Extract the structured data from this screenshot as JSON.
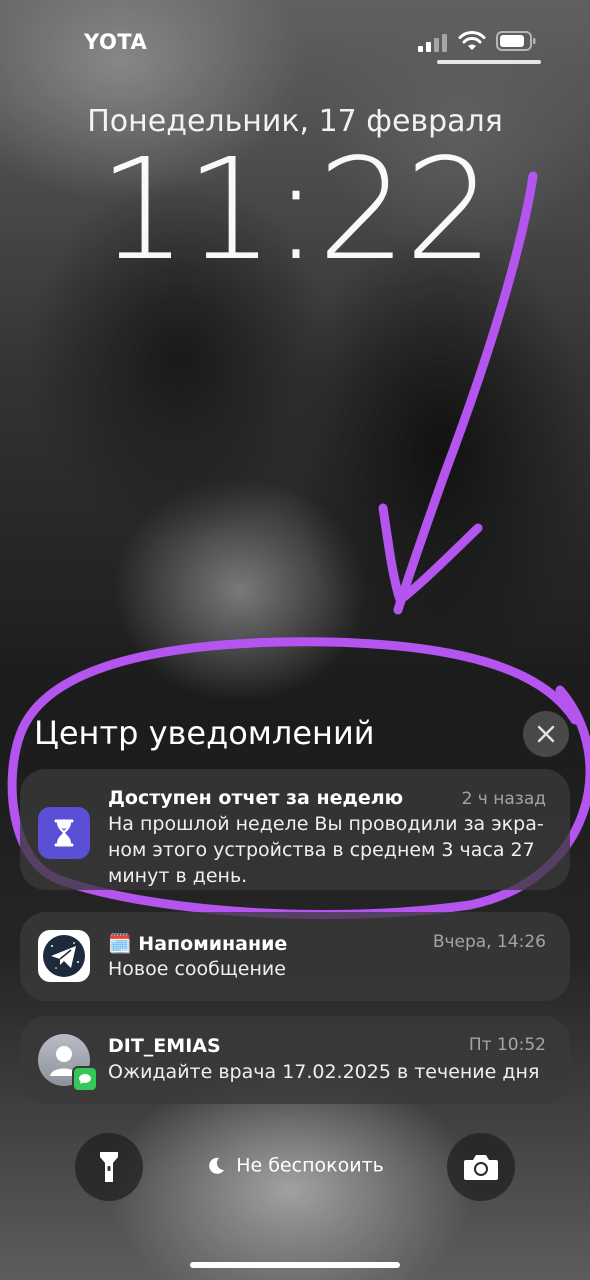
{
  "status_bar": {
    "carrier": "YOTA",
    "signal_bars_active": 2,
    "signal_bars_total": 4
  },
  "lock_screen": {
    "date": "Понедельник, 17 февраля",
    "time": "11:22"
  },
  "notification_center": {
    "title": "Центр уведомлений",
    "close_icon": "xmark-icon",
    "notifications": [
      {
        "app_icon": "hourglass-icon",
        "title": "Доступен отчет за неделю",
        "time": "2 ч назад",
        "body_lines": [
          "На прошлой неделе Вы проводили за экра-",
          "ном этого устройства в среднем 3 часа 27",
          "минут в день."
        ]
      },
      {
        "app_icon": "paper-plane-icon",
        "title_emoji": "🗓️",
        "title": "Напоминание",
        "time": "Вчера, 14:26",
        "body_lines": [
          "Новое сообщение"
        ]
      },
      {
        "app_icon": "person-avatar-icon",
        "badge_icon": "messages-bubble-icon",
        "title": "DIT_EMIAS",
        "time": "Пт 10:52",
        "body_lines": [
          "Ожидайте врача 17.02.2025 в течение дня"
        ]
      }
    ]
  },
  "bottom_bar": {
    "flashlight_icon": "flashlight-icon",
    "dnd_icon": "moon-icon",
    "dnd_label": "Не беспокоить",
    "camera_icon": "camera-icon"
  },
  "colors": {
    "annotation_purple": "#b455f0",
    "screen_time_icon": "#5a4fd6",
    "messages_green": "#34c759"
  }
}
